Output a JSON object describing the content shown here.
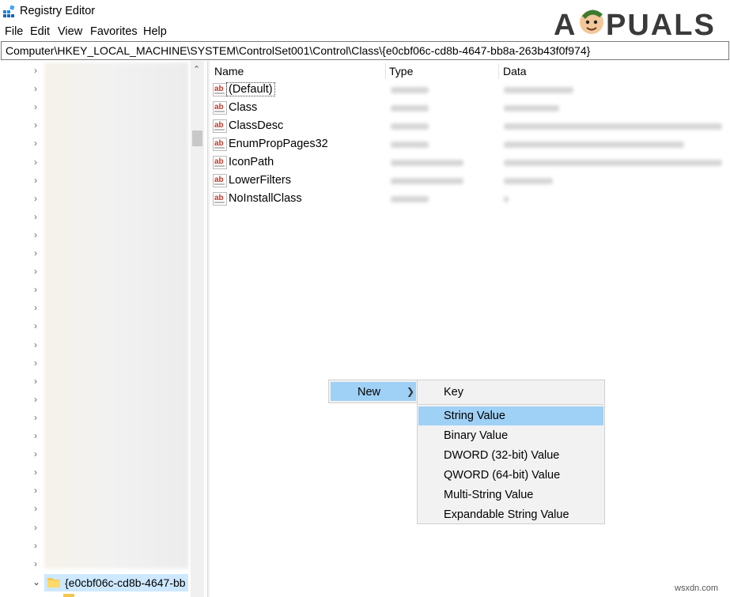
{
  "window": {
    "title": "Registry Editor"
  },
  "menubar": {
    "items": [
      "File",
      "Edit",
      "View",
      "Favorites",
      "Help"
    ]
  },
  "address": {
    "path": "Computer\\HKEY_LOCAL_MACHINE\\SYSTEM\\ControlSet001\\Control\\Class\\{e0cbf06c-cd8b-4647-bb8a-263b43f0f974}"
  },
  "tree": {
    "selected_key": "{e0cbf06c-cd8b-4647-bb"
  },
  "values_list": {
    "headers": {
      "name": "Name",
      "type": "Type",
      "data": "Data"
    },
    "rows": [
      {
        "name": "(Default)",
        "icon": "ab-string-icon"
      },
      {
        "name": "Class",
        "icon": "ab-string-icon"
      },
      {
        "name": "ClassDesc",
        "icon": "ab-string-icon"
      },
      {
        "name": "EnumPropPages32",
        "icon": "ab-string-icon"
      },
      {
        "name": "IconPath",
        "icon": "ab-string-icon"
      },
      {
        "name": "LowerFilters",
        "icon": "ab-string-icon"
      },
      {
        "name": "NoInstallClass",
        "icon": "ab-string-icon"
      }
    ]
  },
  "context_menu": {
    "new_label": "New",
    "submenu": [
      "Key",
      "String Value",
      "Binary Value",
      "DWORD (32-bit) Value",
      "QWORD (64-bit) Value",
      "Multi-String Value",
      "Expandable String Value"
    ],
    "highlighted": "String Value"
  },
  "watermark": {
    "text": "APPUALS"
  },
  "footer": {
    "text": "wsxdn.com"
  },
  "colors": {
    "highlight": "#9fd0f5",
    "selection": "#cde8ff",
    "icon_red": "#c0392b"
  }
}
